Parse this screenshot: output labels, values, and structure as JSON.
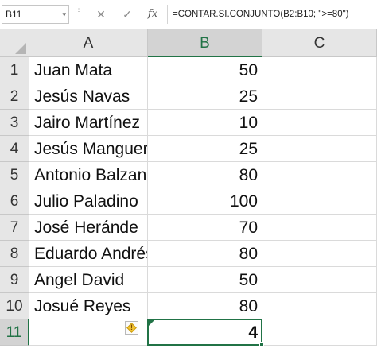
{
  "formula_bar": {
    "name_box": "B11",
    "name_box_arrow": "▾",
    "separator_glyph": "⋮",
    "cancel_glyph": "✕",
    "enter_glyph": "✓",
    "fx_label": "fx",
    "formula": "=CONTAR.SI.CONJUNTO(B2:B10; \">=80\")"
  },
  "columns": [
    "A",
    "B",
    "C"
  ],
  "active_column": "B",
  "active_row": "11",
  "rows": [
    {
      "num": "1",
      "a": "Juan Mata",
      "b": "50"
    },
    {
      "num": "2",
      "a": "Jesús Navas",
      "b": "25"
    },
    {
      "num": "3",
      "a": "Jairo Martínez",
      "b": "10"
    },
    {
      "num": "4",
      "a": "Jesús Manguera",
      "b": "25"
    },
    {
      "num": "5",
      "a": "Antonio Balzano",
      "b": "80"
    },
    {
      "num": "6",
      "a": "Julio Paladino",
      "b": "100"
    },
    {
      "num": "7",
      "a": "José Heránde",
      "b": "70"
    },
    {
      "num": "8",
      "a": "Eduardo Andrés",
      "b": "80"
    },
    {
      "num": "9",
      "a": "Angel David",
      "b": "50"
    },
    {
      "num": "10",
      "a": "Josué Reyes",
      "b": "80"
    },
    {
      "num": "11",
      "a": "",
      "b": "4"
    }
  ],
  "warning_glyph": "!",
  "colors": {
    "accent": "#217346",
    "header_bg": "#e6e6e6",
    "header_active_bg": "#d3d3d3",
    "gridline": "#dadada"
  }
}
